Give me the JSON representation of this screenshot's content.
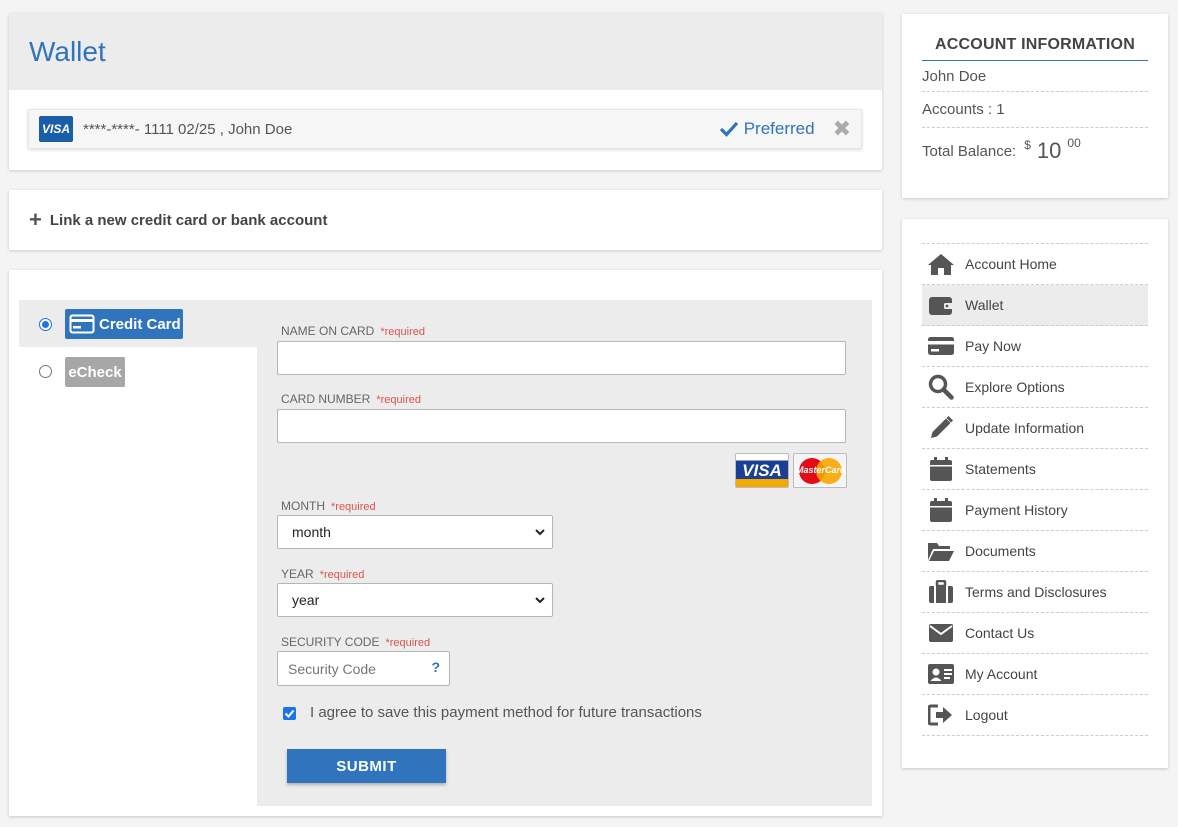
{
  "wallet": {
    "title": "Wallet",
    "card": {
      "brand": "VISA",
      "description": "****-****- 1111 02/25 , John Doe",
      "preferred_label": "Preferred",
      "remove_symbol": "✖"
    }
  },
  "link_new": {
    "label": "Link a new credit card or bank account",
    "icon": "plus-icon"
  },
  "payment": {
    "methods": [
      {
        "label": "Credit Card",
        "selected": true
      },
      {
        "label": "eCheck",
        "selected": false
      }
    ],
    "required_text": "*required",
    "fields": {
      "name_on_card": {
        "label": "NAME ON CARD",
        "value": ""
      },
      "card_number": {
        "label": "CARD NUMBER",
        "value": ""
      },
      "month": {
        "label": "MONTH",
        "value": "month"
      },
      "year": {
        "label": "YEAR",
        "value": "year"
      },
      "security_code": {
        "label": "SECURITY CODE",
        "placeholder": "Security Code",
        "help": "?"
      }
    },
    "accepted_cards": [
      "VISA",
      "MasterCard"
    ],
    "agree": {
      "checked": true,
      "label": "I agree to save this payment method for future transactions"
    },
    "submit_label": "SUBMIT"
  },
  "account_info": {
    "title": "ACCOUNT INFORMATION",
    "name": "John Doe",
    "accounts": "Accounts : 1",
    "balance_label": "Total Balance:",
    "balance_currency": "$",
    "balance_whole": "10",
    "balance_cents": "00"
  },
  "nav": {
    "items": [
      {
        "label": "Account Home",
        "icon": "home-icon"
      },
      {
        "label": "Wallet",
        "icon": "wallet-icon",
        "active": true
      },
      {
        "label": "Pay Now",
        "icon": "credit-card-icon"
      },
      {
        "label": "Explore Options",
        "icon": "search-icon"
      },
      {
        "label": "Update Information",
        "icon": "pencil-icon"
      },
      {
        "label": "Statements",
        "icon": "calendar-icon"
      },
      {
        "label": "Payment History",
        "icon": "calendar-icon"
      },
      {
        "label": "Documents",
        "icon": "folder-open-icon"
      },
      {
        "label": "Terms and Disclosures",
        "icon": "briefcase-icon"
      },
      {
        "label": "Contact Us",
        "icon": "envelope-icon"
      },
      {
        "label": "My Account",
        "icon": "id-card-icon"
      },
      {
        "label": "Logout",
        "icon": "logout-icon"
      }
    ]
  },
  "colors": {
    "accent": "#2f74bd",
    "required": "#d9534f",
    "panel_bg": "#ececec"
  }
}
